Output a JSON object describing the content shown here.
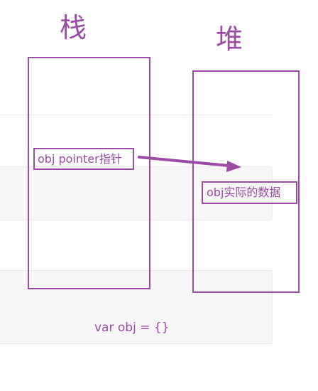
{
  "headings": {
    "stack": "栈",
    "heap": "堆"
  },
  "labels": {
    "pointer": "obj pointer指针",
    "data": "obj实际的数据"
  },
  "code": {
    "declaration": "var obj = {}"
  },
  "colors": {
    "accent": "#9b4aa6",
    "panel_background": "#f7f7f7",
    "divider": "#ececec"
  }
}
